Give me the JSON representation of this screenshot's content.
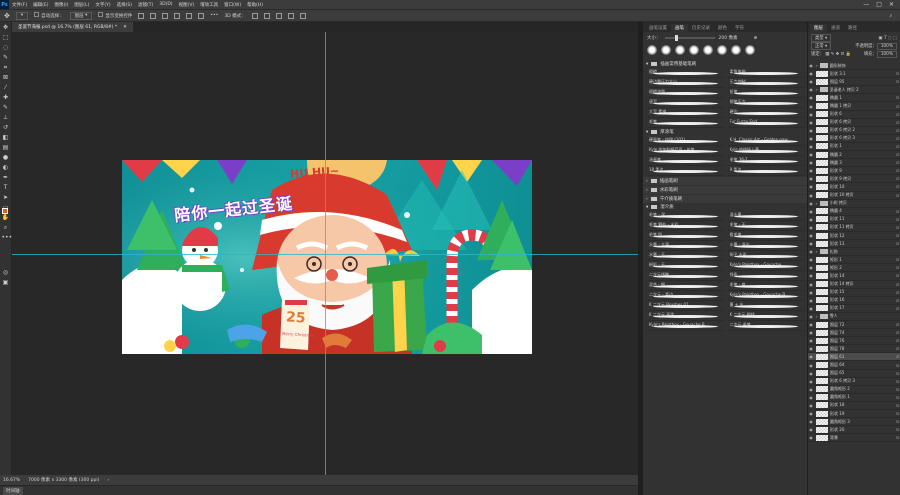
{
  "menubar": {
    "logo": "Ps",
    "items": [
      "文件(F)",
      "编辑(E)",
      "图像(I)",
      "图层(L)",
      "文字(Y)",
      "选择(S)",
      "滤镜(T)",
      "3D(D)",
      "视图(V)",
      "增效工具",
      "窗口(W)",
      "帮助(H)"
    ],
    "window_controls": [
      "—",
      "□",
      "✕"
    ]
  },
  "options_bar": {
    "auto_select_label": "自动选择：",
    "auto_select_value": "图层",
    "show_transform_label": "显示变换控件",
    "mode_3d_label": "3D 模式："
  },
  "document_tab": {
    "title": "圣诞节海报.psd @ 16.7% (图层 61, RGB/8#) *",
    "close": "✕"
  },
  "statusbar": {
    "zoom": "16.67%",
    "doc_info": "7000 像素 x 3300 像素 (300 ppi)"
  },
  "bottombar": {
    "timeline_label": "时间轴"
  },
  "artwork": {
    "headline": "陪你一起过圣诞",
    "speech_bubble": "HU HU~",
    "calendar_number": "25",
    "calendar_caption": "Merry Christmas"
  },
  "brush_panel": {
    "tabs": [
      "画笔设置",
      "画笔",
      "历史记录",
      "颜色",
      "字符"
    ],
    "active_tab": 1,
    "size_label": "大小：",
    "size_value": "200 像素",
    "groups": [
      {
        "name": "插画常用基础笔刷",
        "brushes": [
          "粗糙",
          "柔角笔刷",
          "硬边圆压力大小",
          "压力控制",
          "粗糙流量",
          "铅笔",
          "速写",
          "钢笔压力",
          "大写 素描",
          "硬边",
          "毛笔",
          "Fur Fuzzy End"
        ]
      },
      {
        "name": "厚涂笔",
        "brushes": [
          "硬画笔 - 纹理 (102)",
          "K.H. Classic Art - Golden paw",
          "Kyle 的加利福尼亚 - 炭笔",
          "Kyle 的终极上墨",
          "油画笔",
          "毛笔 36-1",
          "18 柔边",
          "9 柔边"
        ]
      },
      {
        "name": "插画笔刷",
        "brushes": []
      },
      {
        "name": "水彩笔刷",
        "brushes": []
      },
      {
        "name": "干介质笔刷",
        "brushes": []
      },
      {
        "name": "湿介质",
        "brushes": [
          "毛笔 - 湿",
          "湿水墨",
          "毛笔 颗粒 - 水彩",
          "毛笔 - 干",
          "毛笔 M",
          "粗毛笔",
          "水墨 - 大滴",
          "水墨 - 湿边",
          "水墨 - 干",
          "刷子 水彩",
          "粉彩 - 干",
          "Kyle's Paintbox - Gouache",
          "二次元线稿",
          "线条",
          "混合 - 细",
          "毛笔 - 扁",
          "二次元 - 柔边",
          "Kyle's Paintbox - Gouache B",
          "K 二次元 Brushes 01",
          "墨 + 水",
          "K 二次元 平涂",
          "K 二次元 细线",
          "Kyle's Paintbox - Gouache B...",
          "二次元 毛笔"
        ]
      }
    ]
  },
  "layers_panel": {
    "tabs": [
      "图层",
      "通道",
      "路径"
    ],
    "kind_label": "类型",
    "blend_mode": "正常",
    "opacity_label": "不透明度：",
    "opacity_value": "100%",
    "lock_label": "锁定：",
    "fill_label": "填充：",
    "fill_value": "100%",
    "layers": [
      {
        "name": "圆形装饰",
        "type": "folder"
      },
      {
        "name": "形状 3.1",
        "type": "layer"
      },
      {
        "name": "图层 95",
        "type": "layer"
      },
      {
        "name": "圣诞老人 拷贝 2",
        "type": "folder"
      },
      {
        "name": "椭圆 1",
        "type": "layer"
      },
      {
        "name": "椭圆 1 拷贝",
        "type": "layer"
      },
      {
        "name": "形状 6",
        "type": "layer"
      },
      {
        "name": "形状 6 拷贝",
        "type": "layer"
      },
      {
        "name": "形状 6 拷贝 2",
        "type": "layer"
      },
      {
        "name": "形状 6 拷贝 3",
        "type": "layer"
      },
      {
        "name": "形状 1",
        "type": "layer"
      },
      {
        "name": "椭圆 2",
        "type": "layer"
      },
      {
        "name": "椭圆 3",
        "type": "layer"
      },
      {
        "name": "形状 9",
        "type": "layer"
      },
      {
        "name": "形状 9 拷贝",
        "type": "layer"
      },
      {
        "name": "形状 10",
        "type": "layer"
      },
      {
        "name": "形状 10 拷贝",
        "type": "layer"
      },
      {
        "name": "小树 拷贝",
        "type": "folder"
      },
      {
        "name": "椭圆 4",
        "type": "layer"
      },
      {
        "name": "形状 11",
        "type": "layer"
      },
      {
        "name": "形状 11 拷贝",
        "type": "layer"
      },
      {
        "name": "形状 12",
        "type": "layer"
      },
      {
        "name": "形状 13",
        "type": "layer"
      },
      {
        "name": "礼物",
        "type": "folder"
      },
      {
        "name": "矩形 1",
        "type": "layer"
      },
      {
        "name": "矩形 2",
        "type": "layer"
      },
      {
        "name": "形状 14",
        "type": "layer"
      },
      {
        "name": "形状 14 拷贝",
        "type": "layer"
      },
      {
        "name": "形状 15",
        "type": "layer"
      },
      {
        "name": "形状 16",
        "type": "layer"
      },
      {
        "name": "形状 17",
        "type": "layer"
      },
      {
        "name": "雪人",
        "type": "folder"
      },
      {
        "name": "图层 72",
        "type": "layer"
      },
      {
        "name": "图层 74",
        "type": "layer"
      },
      {
        "name": "图层 76",
        "type": "layer"
      },
      {
        "name": "图层 78",
        "type": "layer"
      },
      {
        "name": "图层 61",
        "type": "layer",
        "selected": true
      },
      {
        "name": "图层 64",
        "type": "layer"
      },
      {
        "name": "图层 65",
        "type": "layer"
      },
      {
        "name": "形状 6 拷贝 3",
        "type": "layer"
      },
      {
        "name": "圆角矩形 2",
        "type": "layer"
      },
      {
        "name": "圆角矩形 1",
        "type": "layer"
      },
      {
        "name": "形状 18",
        "type": "layer"
      },
      {
        "name": "形状 19",
        "type": "layer"
      },
      {
        "name": "圆角矩形 3",
        "type": "layer"
      },
      {
        "name": "形状 20",
        "type": "layer"
      },
      {
        "name": "背景",
        "type": "layer"
      }
    ]
  },
  "colors": {
    "accent": "#31a8ff",
    "guide": "#27b9c9",
    "foreground": "#d9621e",
    "background": "#ffffff"
  }
}
